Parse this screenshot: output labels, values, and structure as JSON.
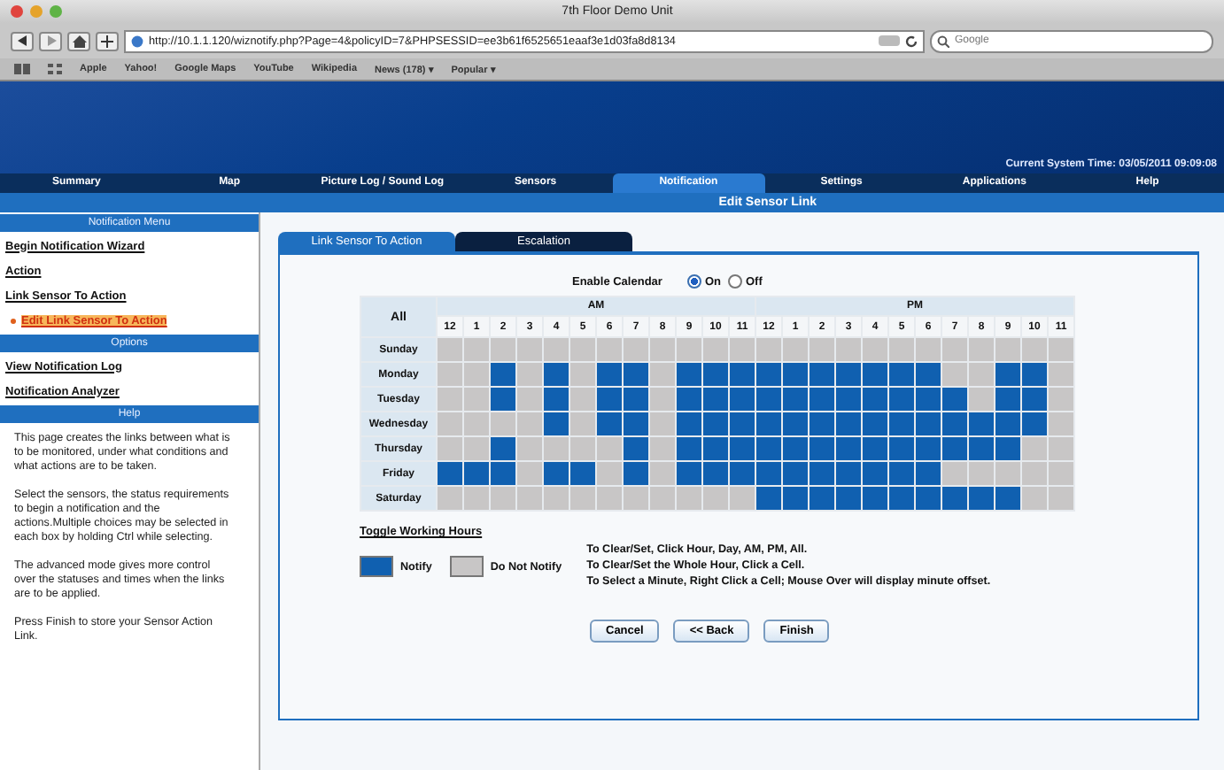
{
  "window": {
    "title": "7th Floor Demo Unit"
  },
  "browser": {
    "url": "http://10.1.1.120/wiznotify.php?Page=4&policyID=7&PHPSESSID=ee3b61f6525651eaaf3e1d03fa8d8134",
    "search": {
      "placeholder": "Google"
    },
    "bookmarks": [
      "Apple",
      "Yahoo!",
      "Google Maps",
      "YouTube",
      "Wikipedia",
      "News (178) ▾",
      "Popular ▾"
    ]
  },
  "header": {
    "system_time": "Current System Time: 03/05/2011 09:09:08"
  },
  "nav": [
    {
      "label": "Summary",
      "selected": false
    },
    {
      "label": "Map",
      "selected": false
    },
    {
      "label": "Picture Log / Sound Log",
      "selected": false
    },
    {
      "label": "Sensors",
      "selected": false
    },
    {
      "label": "Notification",
      "selected": true
    },
    {
      "label": "Settings",
      "selected": false
    },
    {
      "label": "Applications",
      "selected": false
    },
    {
      "label": "Help",
      "selected": false
    }
  ],
  "page_title": "Edit Sensor Link",
  "sidebar": {
    "sections": [
      {
        "title": "Notification Menu",
        "items": [
          {
            "label": "Begin Notification Wizard",
            "selected": false
          },
          {
            "label": "Action",
            "selected": false
          },
          {
            "label": "Link Sensor To Action",
            "selected": false,
            "children": [
              {
                "label": "Edit Link Sensor To Action",
                "selected": true
              }
            ]
          }
        ]
      },
      {
        "title": "Options",
        "items": [
          {
            "label": "View Notification Log",
            "selected": false
          },
          {
            "label": "Notification Analyzer",
            "selected": false
          }
        ]
      },
      {
        "title": "Help",
        "paragraphs": [
          "This page creates the links between what is to be monitored, under what conditions and what actions are to be taken.",
          "Select the sensors, the status requirements to begin a notification and the actions.Multiple choices may be selected in each box by holding Ctrl while selecting.",
          "The advanced mode gives more control over the statuses and times when the links are to be applied.",
          "Press Finish to store your Sensor Action Link."
        ]
      }
    ]
  },
  "tabs": [
    {
      "label": "Link Sensor To Action",
      "selected": true
    },
    {
      "label": "Escalation",
      "selected": false
    }
  ],
  "calendar": {
    "label": "Enable Calendar",
    "options": [
      {
        "label": "On",
        "selected": true
      },
      {
        "label": "Off",
        "selected": false
      }
    ]
  },
  "schedule": {
    "all": "All",
    "periods": [
      "AM",
      "PM"
    ],
    "hours": [
      "12",
      "1",
      "2",
      "3",
      "4",
      "5",
      "6",
      "7",
      "8",
      "9",
      "10",
      "11",
      "12",
      "1",
      "2",
      "3",
      "4",
      "5",
      "6",
      "7",
      "8",
      "9",
      "10",
      "11"
    ],
    "rows": [
      {
        "day": "Sunday",
        "cells": [
          false,
          false,
          false,
          false,
          false,
          false,
          false,
          false,
          false,
          false,
          false,
          false,
          false,
          false,
          false,
          false,
          false,
          false,
          false,
          false,
          false,
          false,
          false,
          false
        ]
      },
      {
        "day": "Monday",
        "cells": [
          false,
          false,
          true,
          false,
          true,
          false,
          true,
          true,
          false,
          true,
          true,
          true,
          true,
          true,
          true,
          true,
          true,
          true,
          true,
          false,
          false,
          true,
          true,
          false
        ]
      },
      {
        "day": "Tuesday",
        "cells": [
          false,
          false,
          true,
          false,
          true,
          false,
          true,
          true,
          false,
          true,
          true,
          true,
          true,
          true,
          true,
          true,
          true,
          true,
          true,
          true,
          false,
          true,
          true,
          false
        ]
      },
      {
        "day": "Wednesday",
        "cells": [
          false,
          false,
          false,
          false,
          true,
          false,
          true,
          true,
          false,
          true,
          true,
          true,
          true,
          true,
          true,
          true,
          true,
          true,
          true,
          true,
          true,
          true,
          true,
          false
        ]
      },
      {
        "day": "Thursday",
        "cells": [
          false,
          false,
          true,
          false,
          false,
          false,
          false,
          true,
          false,
          true,
          true,
          true,
          true,
          true,
          true,
          true,
          true,
          true,
          true,
          true,
          true,
          true,
          false,
          false
        ]
      },
      {
        "day": "Friday",
        "cells": [
          true,
          true,
          true,
          false,
          true,
          true,
          false,
          true,
          false,
          true,
          true,
          true,
          true,
          true,
          true,
          true,
          true,
          true,
          true,
          false,
          false,
          false,
          false,
          false
        ]
      },
      {
        "day": "Saturday",
        "cells": [
          false,
          false,
          false,
          false,
          false,
          false,
          false,
          false,
          false,
          false,
          false,
          false,
          true,
          true,
          true,
          true,
          true,
          true,
          true,
          true,
          true,
          true,
          false,
          false
        ]
      }
    ]
  },
  "toggle_link": "Toggle Working Hours",
  "legend": [
    {
      "label": "Notify",
      "color": "#1060b0"
    },
    {
      "label": "Do Not Notify",
      "color": "#c8c6c6"
    }
  ],
  "instructions": [
    "To Clear/Set, Click Hour, Day, AM, PM, All.",
    "To Clear/Set the Whole Hour, Click a Cell.",
    "To Select a Minute, Right Click a Cell; Mouse Over will display minute offset."
  ],
  "buttons": [
    "Cancel",
    "<< Back",
    "Finish"
  ]
}
